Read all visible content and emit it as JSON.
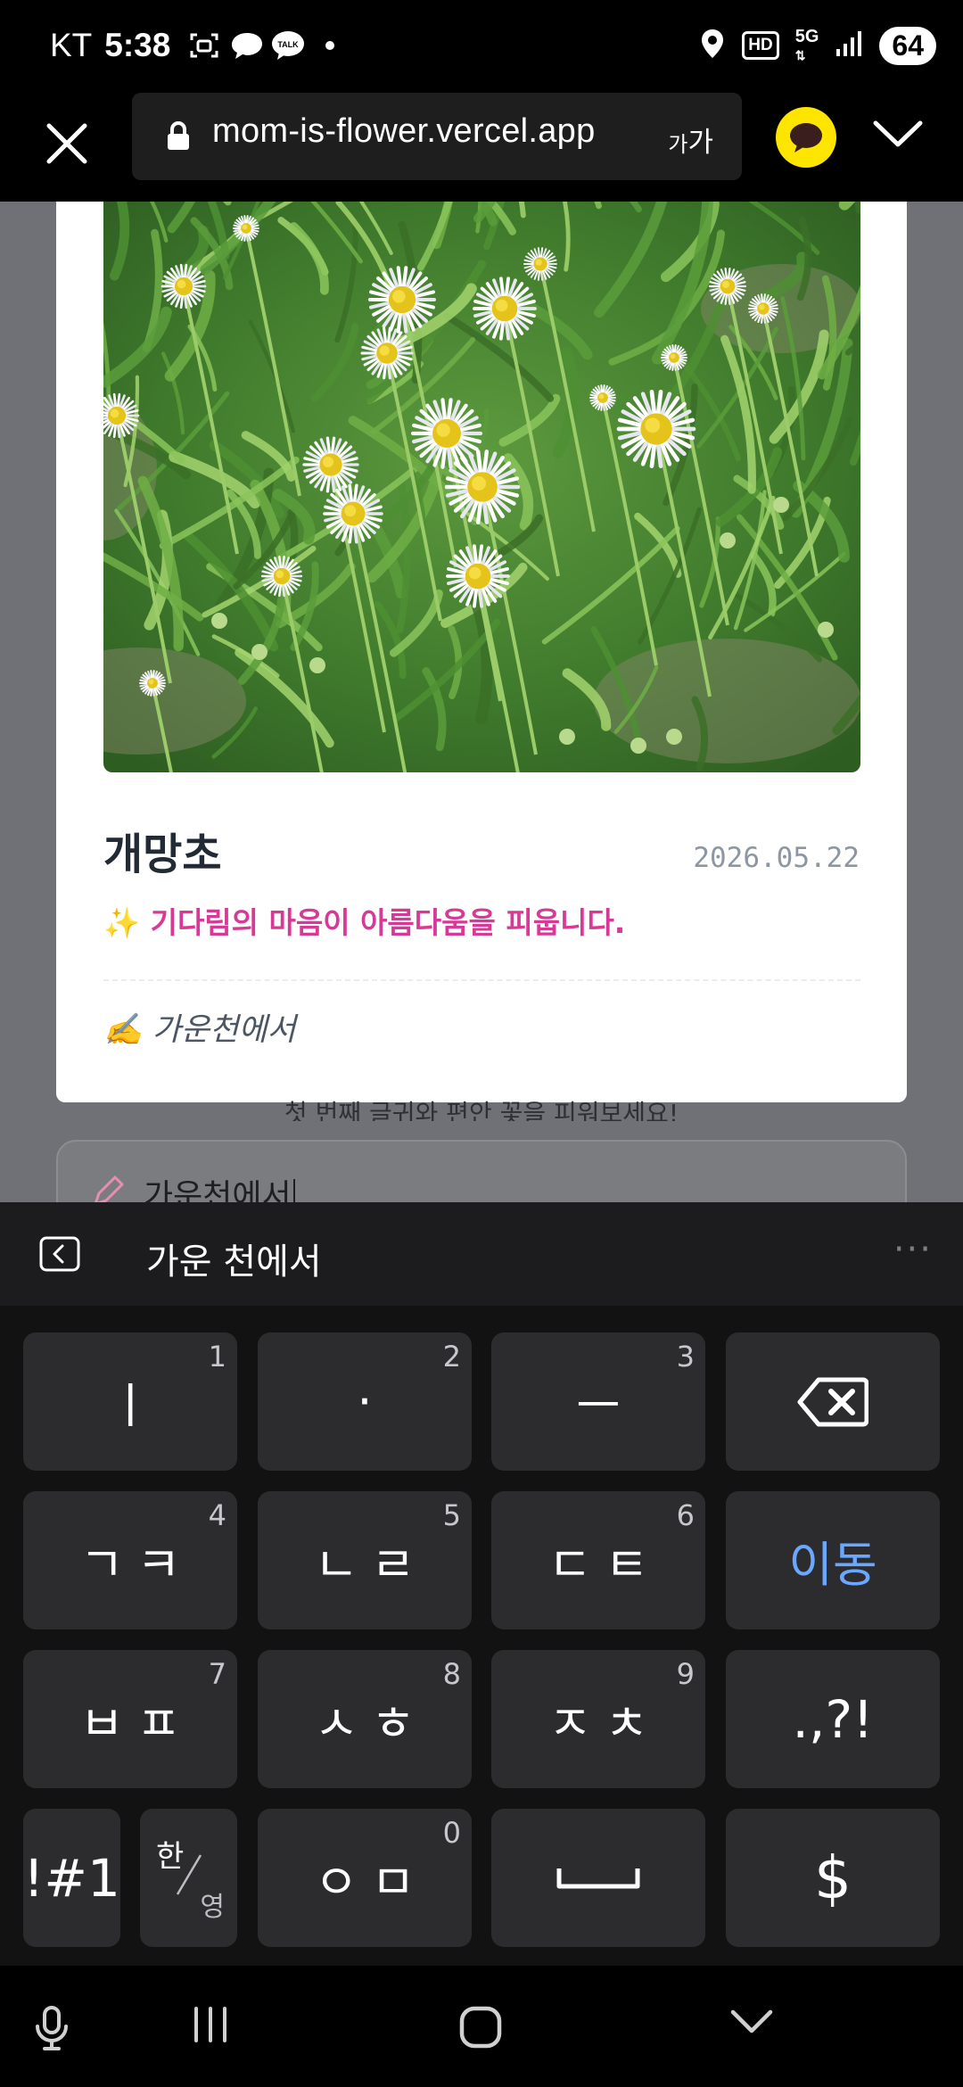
{
  "status_bar": {
    "carrier": "KT",
    "time": "5:38",
    "hd": "HD",
    "network": "5G",
    "battery": "64",
    "icons": [
      "screenshot-icon",
      "chat-bubble-icon",
      "kakaotalk-icon",
      "dot-icon",
      "location-icon",
      "signal-icon"
    ]
  },
  "browser": {
    "url": "mom-is-flower.vercel.app",
    "text_size_label_small": "가",
    "text_size_label_large": "가",
    "icons": [
      "close-icon",
      "lock-icon",
      "kakaotalk-icon",
      "chevron-down-icon"
    ],
    "kakao_color": "#fee500"
  },
  "card": {
    "flower_name": "개망초",
    "date": "2026.05.22",
    "message": "✨ 기다림의 마음이 아름다움을 피웁니다.",
    "signature": "✍️ 가운천에서",
    "message_color": "#d63a96"
  },
  "page": {
    "hint_text": "첫 번째 글귀와 편안 꽃을 피워보세요!",
    "memo_value": "가운천에서",
    "memo_icon": "pencil-icon"
  },
  "keyboard": {
    "suggestion": "가운 천에서",
    "suggestion_more": "···",
    "rows": [
      [
        {
          "label": "ㅣ",
          "num": "1"
        },
        {
          "label": "·",
          "num": "2"
        },
        {
          "label": "ㅡ",
          "num": "3"
        },
        {
          "label": "",
          "icon": "backspace-icon"
        }
      ],
      [
        {
          "label": "ㄱㅋ",
          "num": "4"
        },
        {
          "label": "ㄴㄹ",
          "num": "5"
        },
        {
          "label": "ㄷㅌ",
          "num": "6"
        },
        {
          "label": "이동"
        }
      ],
      [
        {
          "label": "ㅂㅍ",
          "num": "7"
        },
        {
          "label": "ㅅㅎ",
          "num": "8"
        },
        {
          "label": "ㅈㅊ",
          "num": "9"
        },
        {
          "label": ".,?!"
        }
      ],
      [
        {
          "label": "!#1"
        },
        {
          "label": "한",
          "sub": "영"
        },
        {
          "label": "ㅇㅁ",
          "num": "0"
        },
        {
          "label": "",
          "icon": "space-icon"
        },
        {
          "label": "$"
        }
      ]
    ],
    "accent_color": "#6aa8ff"
  },
  "nav_bar": {
    "icons": [
      "microphone-icon",
      "recent-apps-icon",
      "home-icon",
      "hide-keyboard-icon"
    ]
  }
}
